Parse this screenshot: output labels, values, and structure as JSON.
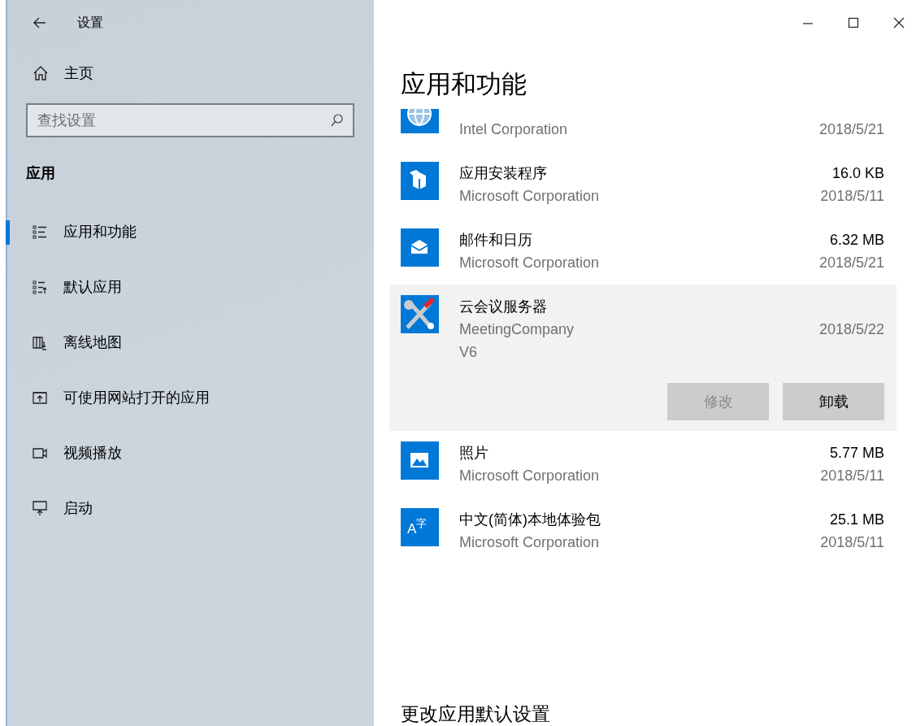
{
  "window": {
    "title": "设置"
  },
  "sidebar": {
    "home": "主页",
    "search": {
      "placeholder": "查找设置"
    },
    "section": "应用",
    "items": [
      {
        "kind": "list",
        "label": "应用和功能",
        "selected": true
      },
      {
        "kind": "defaults",
        "label": "默认应用",
        "selected": false
      },
      {
        "kind": "map",
        "label": "离线地图",
        "selected": false
      },
      {
        "kind": "web",
        "label": "可使用网站打开的应用",
        "selected": false
      },
      {
        "kind": "video",
        "label": "视频播放",
        "selected": false
      },
      {
        "kind": "startup",
        "label": "启动",
        "selected": false
      }
    ]
  },
  "main": {
    "title": "应用和功能",
    "apps": [
      {
        "kind": "globe",
        "publisher": "Intel Corporation",
        "date": "2018/5/21",
        "selected": false
      },
      {
        "kind": "box",
        "name": "应用安装程序",
        "publisher": "Microsoft Corporation",
        "size": "16.0 KB",
        "date": "2018/5/11",
        "selected": false
      },
      {
        "kind": "envelope",
        "name": "邮件和日历",
        "publisher": "Microsoft Corporation",
        "size": "6.32 MB",
        "date": "2018/5/21",
        "selected": false
      },
      {
        "kind": "tools",
        "name": "云会议服务器",
        "publisher": "MeetingCompany",
        "version": "V6",
        "date": "2018/5/22",
        "selected": true,
        "buttons": [
          {
            "label": "修改",
            "disabled": true
          },
          {
            "label": "卸载",
            "disabled": false
          }
        ]
      },
      {
        "kind": "photo",
        "name": "照片",
        "publisher": "Microsoft Corporation",
        "size": "5.77 MB",
        "date": "2018/5/11",
        "selected": false
      },
      {
        "kind": "glyph",
        "icon_text": "A",
        "icon_sup": "字",
        "name": "中文(简体)本地体验包",
        "publisher": "Microsoft Corporation",
        "size": "25.1 MB",
        "date": "2018/5/11",
        "selected": false
      }
    ],
    "footer_heading": "更改应用默认设置"
  }
}
